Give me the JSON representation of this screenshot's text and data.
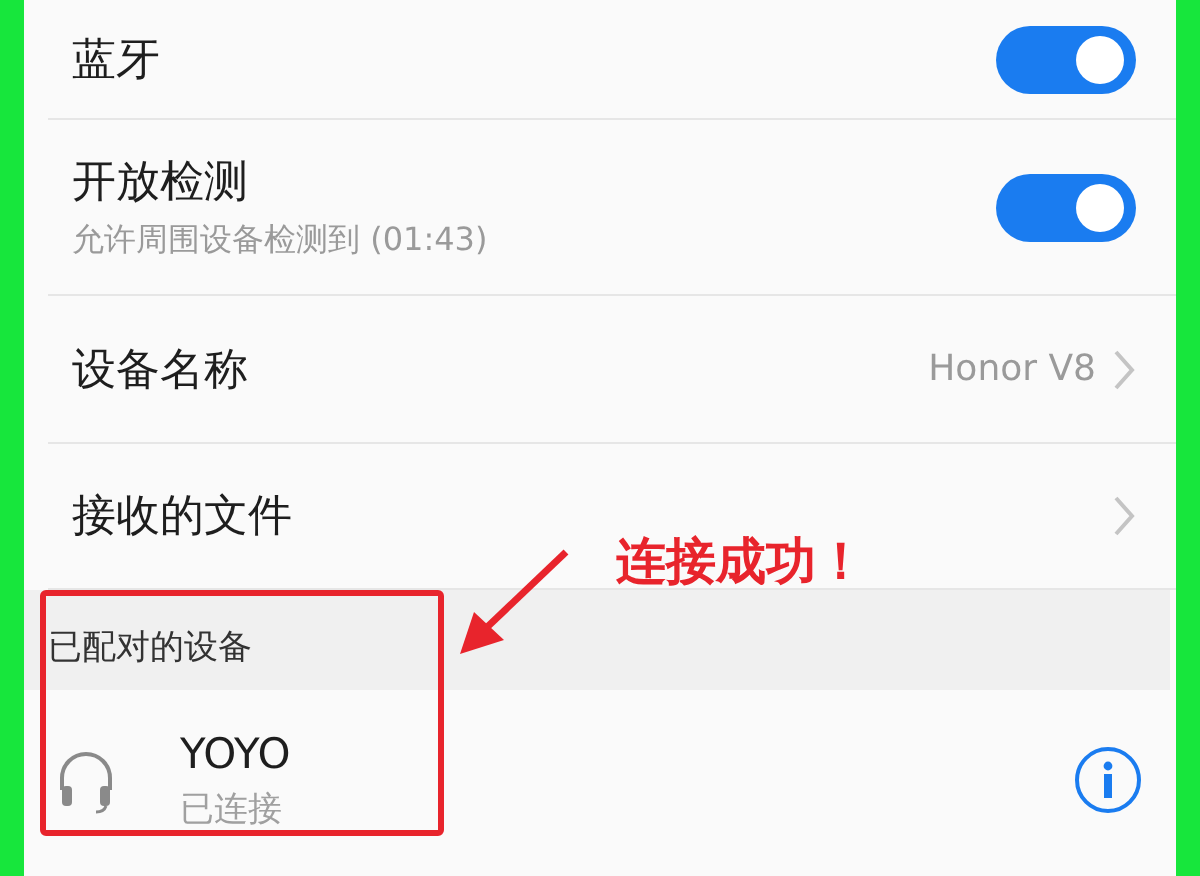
{
  "settings": [
    {
      "kind": "toggle",
      "title": "蓝牙",
      "on": true
    },
    {
      "kind": "toggle",
      "title": "开放检测",
      "subtitle": "允许周围设备检测到 (01:43)",
      "on": true
    },
    {
      "kind": "link",
      "title": "设备名称",
      "value": "Honor V8"
    },
    {
      "kind": "link",
      "title": "接收的文件"
    }
  ],
  "paired_section": {
    "title": "已配对的设备",
    "devices": [
      {
        "name": "YOYO",
        "status": "已连接"
      }
    ]
  },
  "annotation": {
    "text": "连接成功！"
  }
}
